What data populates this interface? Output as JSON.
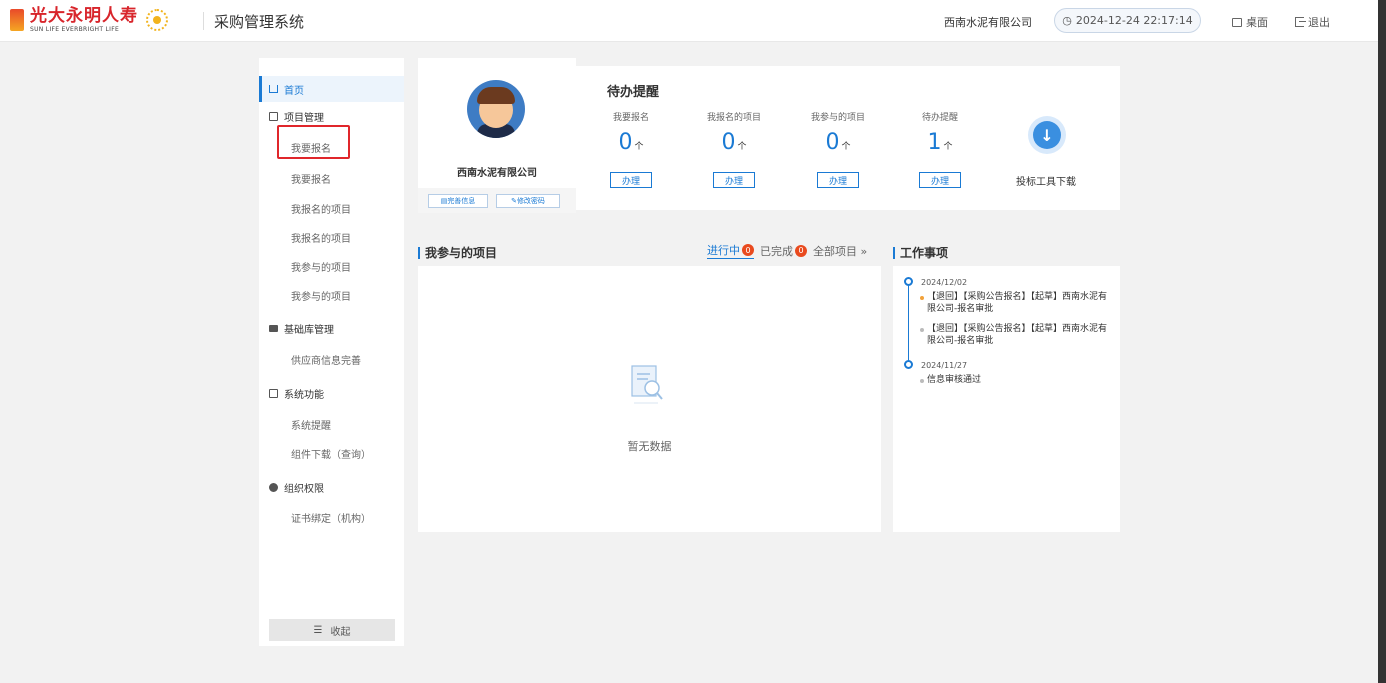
{
  "header": {
    "logo_cn": "光大永明人寿",
    "logo_en": "SUN LIFE EVERBRIGHT LIFE",
    "system_title": "采购管理系统",
    "company": "西南水泥有限公司",
    "datetime": "2024-12-24 22:17:14",
    "desktop_label": "桌面",
    "logout_label": "退出"
  },
  "sidebar": {
    "home": "首页",
    "groups": [
      {
        "label": "项目管理",
        "icon": "folder-icon"
      },
      {
        "label": "基础库管理",
        "icon": "database-icon"
      },
      {
        "label": "系统功能",
        "icon": "monitor-icon"
      },
      {
        "label": "组织权限",
        "icon": "shield-icon"
      }
    ],
    "project_items": [
      "我要报名",
      "我要报名",
      "我报名的项目",
      "我报名的项目",
      "我参与的项目",
      "我参与的项目"
    ],
    "base_items": [
      "供应商信息完善"
    ],
    "system_items": [
      "系统提醒",
      "组件下载（查询）"
    ],
    "org_items": [
      "证书绑定（机构）"
    ],
    "collapse": "收起"
  },
  "profile": {
    "name": "西南水泥有限公司",
    "complete_info": "完善信息",
    "change_password": "修改密码"
  },
  "todo": {
    "title": "待办提醒",
    "stats": [
      {
        "label": "我要报名",
        "value": "0",
        "unit": "个",
        "action": "办理"
      },
      {
        "label": "我报名的项目",
        "value": "0",
        "unit": "个",
        "action": "办理"
      },
      {
        "label": "我参与的项目",
        "value": "0",
        "unit": "个",
        "action": "办理"
      },
      {
        "label": "待办提醒",
        "value": "1",
        "unit": "个",
        "action": "办理"
      }
    ],
    "download_label": "投标工具下载"
  },
  "projects": {
    "title": "我参与的项目",
    "tabs": [
      {
        "label": "进行中",
        "badge": "0"
      },
      {
        "label": "已完成",
        "badge": "0"
      },
      {
        "label": "全部项目 »"
      }
    ],
    "empty_text": "暂无数据"
  },
  "work": {
    "title": "工作事项",
    "groups": [
      {
        "date": "2024/12/02",
        "entries": [
          "【退回】【采购公告报名】【起草】西南水泥有限公司-报名审批",
          "【退回】【采购公告报名】【起草】西南水泥有限公司-报名审批"
        ]
      },
      {
        "date": "2024/11/27",
        "entries": [
          "信息审核通过"
        ]
      }
    ]
  },
  "colors": {
    "accent": "#1a7ad4",
    "badge": "#e94a1e",
    "highlight_box": "#e0262b"
  }
}
